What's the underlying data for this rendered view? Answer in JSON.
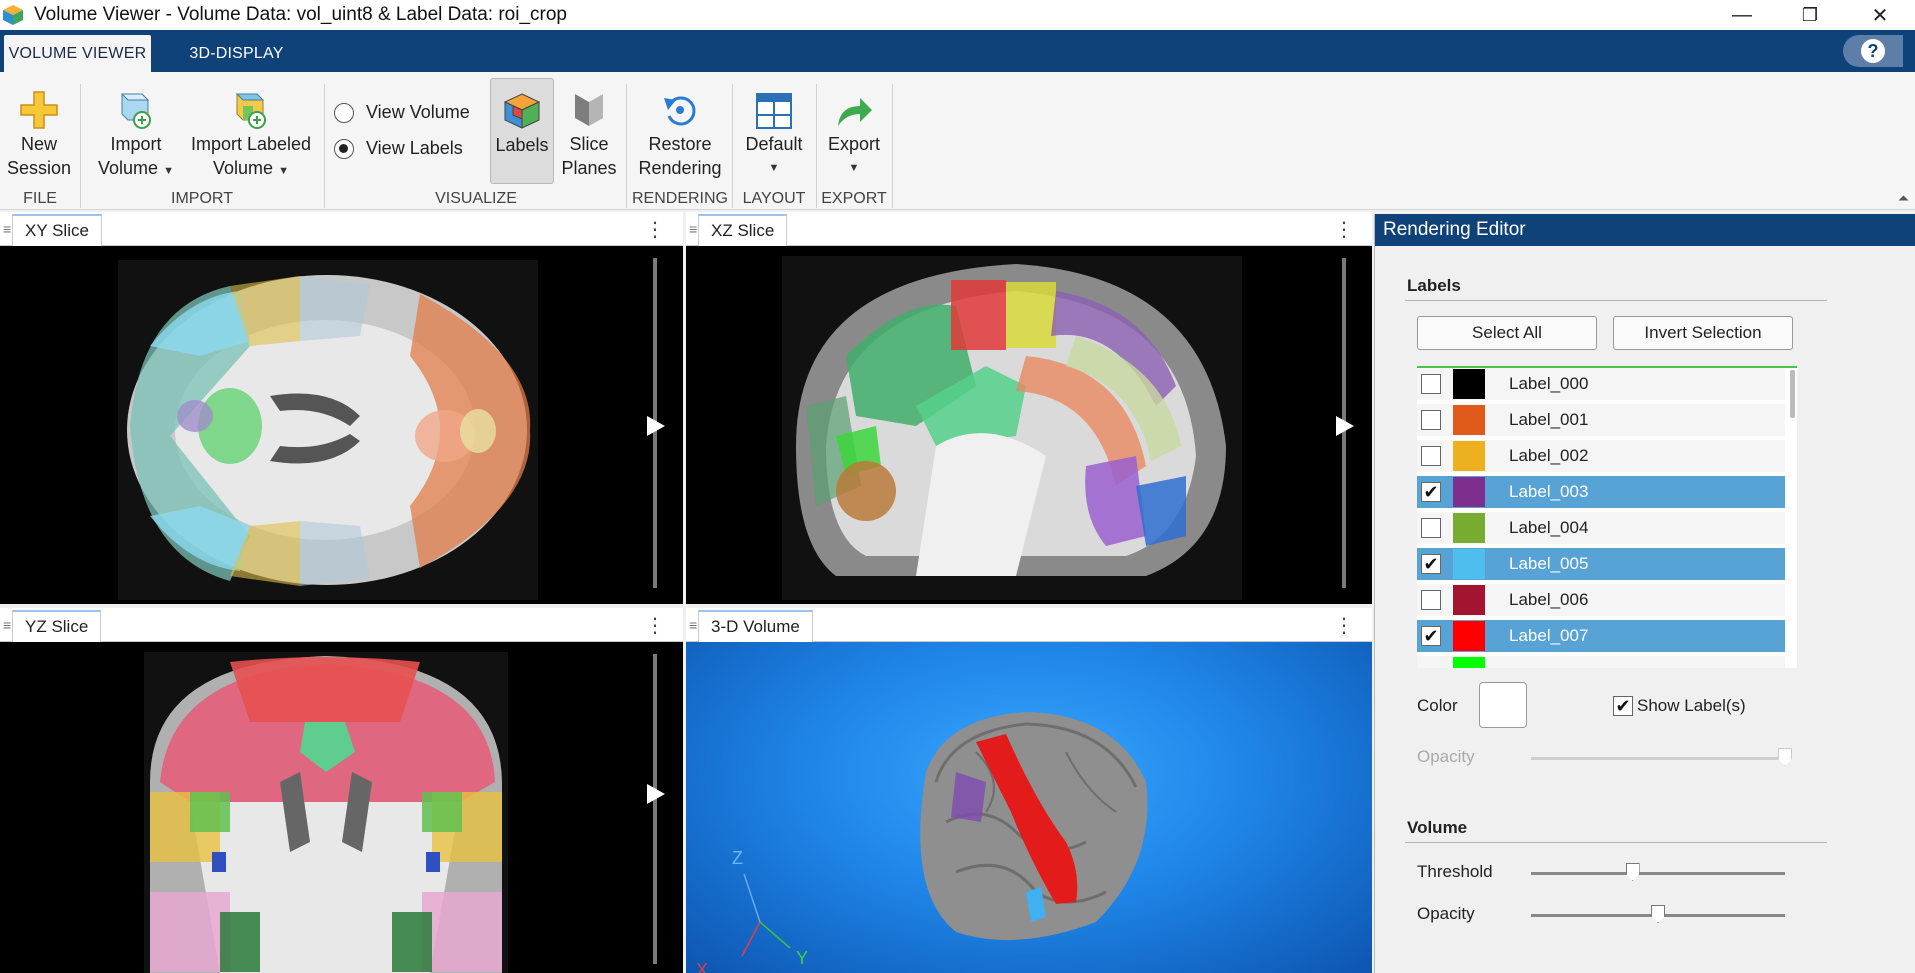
{
  "window": {
    "title": "Volume Viewer - Volume Data: vol_uint8 & Label Data: roi_crop",
    "controls": {
      "minimize": "—",
      "restore": "❐",
      "close": "✕"
    }
  },
  "tabs": [
    {
      "label": "VOLUME VIEWER",
      "active": true
    },
    {
      "label": "3D-DISPLAY",
      "active": false
    }
  ],
  "help": {
    "label": "?"
  },
  "ribbon": {
    "new_session": {
      "line1": "New",
      "line2": "Session"
    },
    "import_volume": {
      "line1": "Import",
      "line2": "Volume"
    },
    "import_labeled": {
      "line1": "Import Labeled",
      "line2": "Volume"
    },
    "view_volume": "View Volume",
    "view_labels": "View Labels",
    "labels": "Labels",
    "slice_planes": {
      "line1": "Slice",
      "line2": "Planes"
    },
    "restore": {
      "line1": "Restore",
      "line2": "Rendering"
    },
    "default": "Default",
    "export": "Export",
    "sections": {
      "file": "FILE",
      "import": "IMPORT",
      "visualize": "VISUALIZE",
      "rendering": "RENDERING",
      "layout": "LAYOUT",
      "export": "EXPORT"
    }
  },
  "panes": {
    "xy": "XY Slice",
    "xz": "XZ Slice",
    "yz": "YZ Slice",
    "vol3d": "3-D Volume",
    "menu": "⋮",
    "grip": "≡"
  },
  "axes": {
    "x": "X",
    "y": "Y",
    "z": "Z"
  },
  "editor": {
    "title": "Rendering Editor",
    "labels_section": "Labels",
    "select_all": "Select All",
    "invert_selection": "Invert Selection",
    "labels": [
      {
        "name": "Label_000",
        "color": "#000000",
        "checked": false
      },
      {
        "name": "Label_001",
        "color": "#e05a1a",
        "checked": false
      },
      {
        "name": "Label_002",
        "color": "#edb120",
        "checked": false
      },
      {
        "name": "Label_003",
        "color": "#7e2f8e",
        "checked": true
      },
      {
        "name": "Label_004",
        "color": "#77ac30",
        "checked": false
      },
      {
        "name": "Label_005",
        "color": "#4dbeee",
        "checked": true
      },
      {
        "name": "Label_006",
        "color": "#a2142f",
        "checked": false
      },
      {
        "name": "Label_007",
        "color": "#ff0000",
        "checked": true
      },
      {
        "name": "",
        "color": "#00ff00",
        "checked": false
      }
    ],
    "color_label": "Color",
    "show_labels": "Show Label(s)",
    "show_labels_checked": true,
    "opacity_label": "Opacity",
    "volume_section": "Volume",
    "threshold_label": "Threshold",
    "volume_opacity_label": "Opacity",
    "threshold_value": 0.4,
    "volume_opacity_value": 0.5,
    "label_opacity_value": 1.0
  }
}
